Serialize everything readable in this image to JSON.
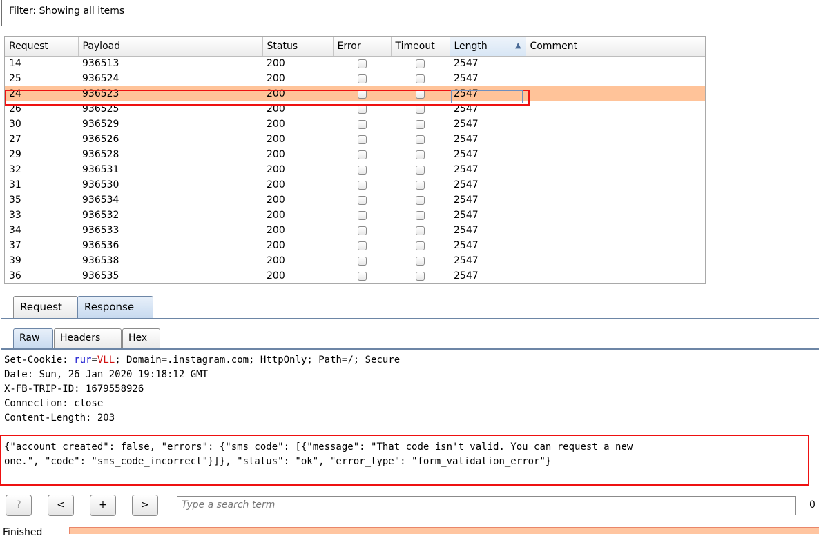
{
  "filter": {
    "text": "Filter: Showing all items"
  },
  "results_table": {
    "columns": [
      "Request",
      "Payload",
      "Status",
      "Error",
      "Timeout",
      "Length",
      "Comment"
    ],
    "sorted_column": "Length",
    "sort_indicator": "▲",
    "rows": [
      {
        "request": "14",
        "payload": "936513",
        "status": "200",
        "length": "2547"
      },
      {
        "request": "25",
        "payload": "936524",
        "status": "200",
        "length": "2547"
      },
      {
        "request": "24",
        "payload": "936523",
        "status": "200",
        "length": "2547",
        "selected": true
      },
      {
        "request": "26",
        "payload": "936525",
        "status": "200",
        "length": "2547"
      },
      {
        "request": "30",
        "payload": "936529",
        "status": "200",
        "length": "2547"
      },
      {
        "request": "27",
        "payload": "936526",
        "status": "200",
        "length": "2547"
      },
      {
        "request": "29",
        "payload": "936528",
        "status": "200",
        "length": "2547"
      },
      {
        "request": "32",
        "payload": "936531",
        "status": "200",
        "length": "2547"
      },
      {
        "request": "31",
        "payload": "936530",
        "status": "200",
        "length": "2547"
      },
      {
        "request": "35",
        "payload": "936534",
        "status": "200",
        "length": "2547"
      },
      {
        "request": "33",
        "payload": "936532",
        "status": "200",
        "length": "2547"
      },
      {
        "request": "34",
        "payload": "936533",
        "status": "200",
        "length": "2547"
      },
      {
        "request": "37",
        "payload": "936536",
        "status": "200",
        "length": "2547"
      },
      {
        "request": "39",
        "payload": "936538",
        "status": "200",
        "length": "2547"
      },
      {
        "request": "36",
        "payload": "936535",
        "status": "200",
        "length": "2547"
      }
    ]
  },
  "tabs": {
    "request": "Request",
    "response": "Response",
    "active": "Response"
  },
  "subtabs": {
    "raw": "Raw",
    "headers": "Headers",
    "hex": "Hex",
    "active": "Raw"
  },
  "response": {
    "set_cookie_prefix": "Set-Cookie: ",
    "cookie_name": "rur",
    "cookie_eq": "=",
    "cookie_value": "VLL",
    "cookie_rest": "; Domain=.instagram.com; HttpOnly; Path=/; Secure",
    "header_lines": [
      "Date: Sun, 26 Jan 2020 19:18:12 GMT",
      "X-FB-TRIP-ID: 1679558926",
      "Connection: close",
      "Content-Length: 203"
    ],
    "body_line_1": "{\"account_created\": false, \"errors\": {\"sms_code\": [{\"message\": \"That code isn't valid. You can request a new",
    "body_line_2": "one.\", \"code\": \"sms_code_incorrect\"}]}, \"status\": \"ok\", \"error_type\": \"form_validation_error\"}"
  },
  "search": {
    "help_label": "?",
    "prev_label": "<",
    "add_label": "+",
    "next_label": ">",
    "placeholder": "Type a search term",
    "matches": "0"
  },
  "footer": {
    "label": "Finished"
  }
}
